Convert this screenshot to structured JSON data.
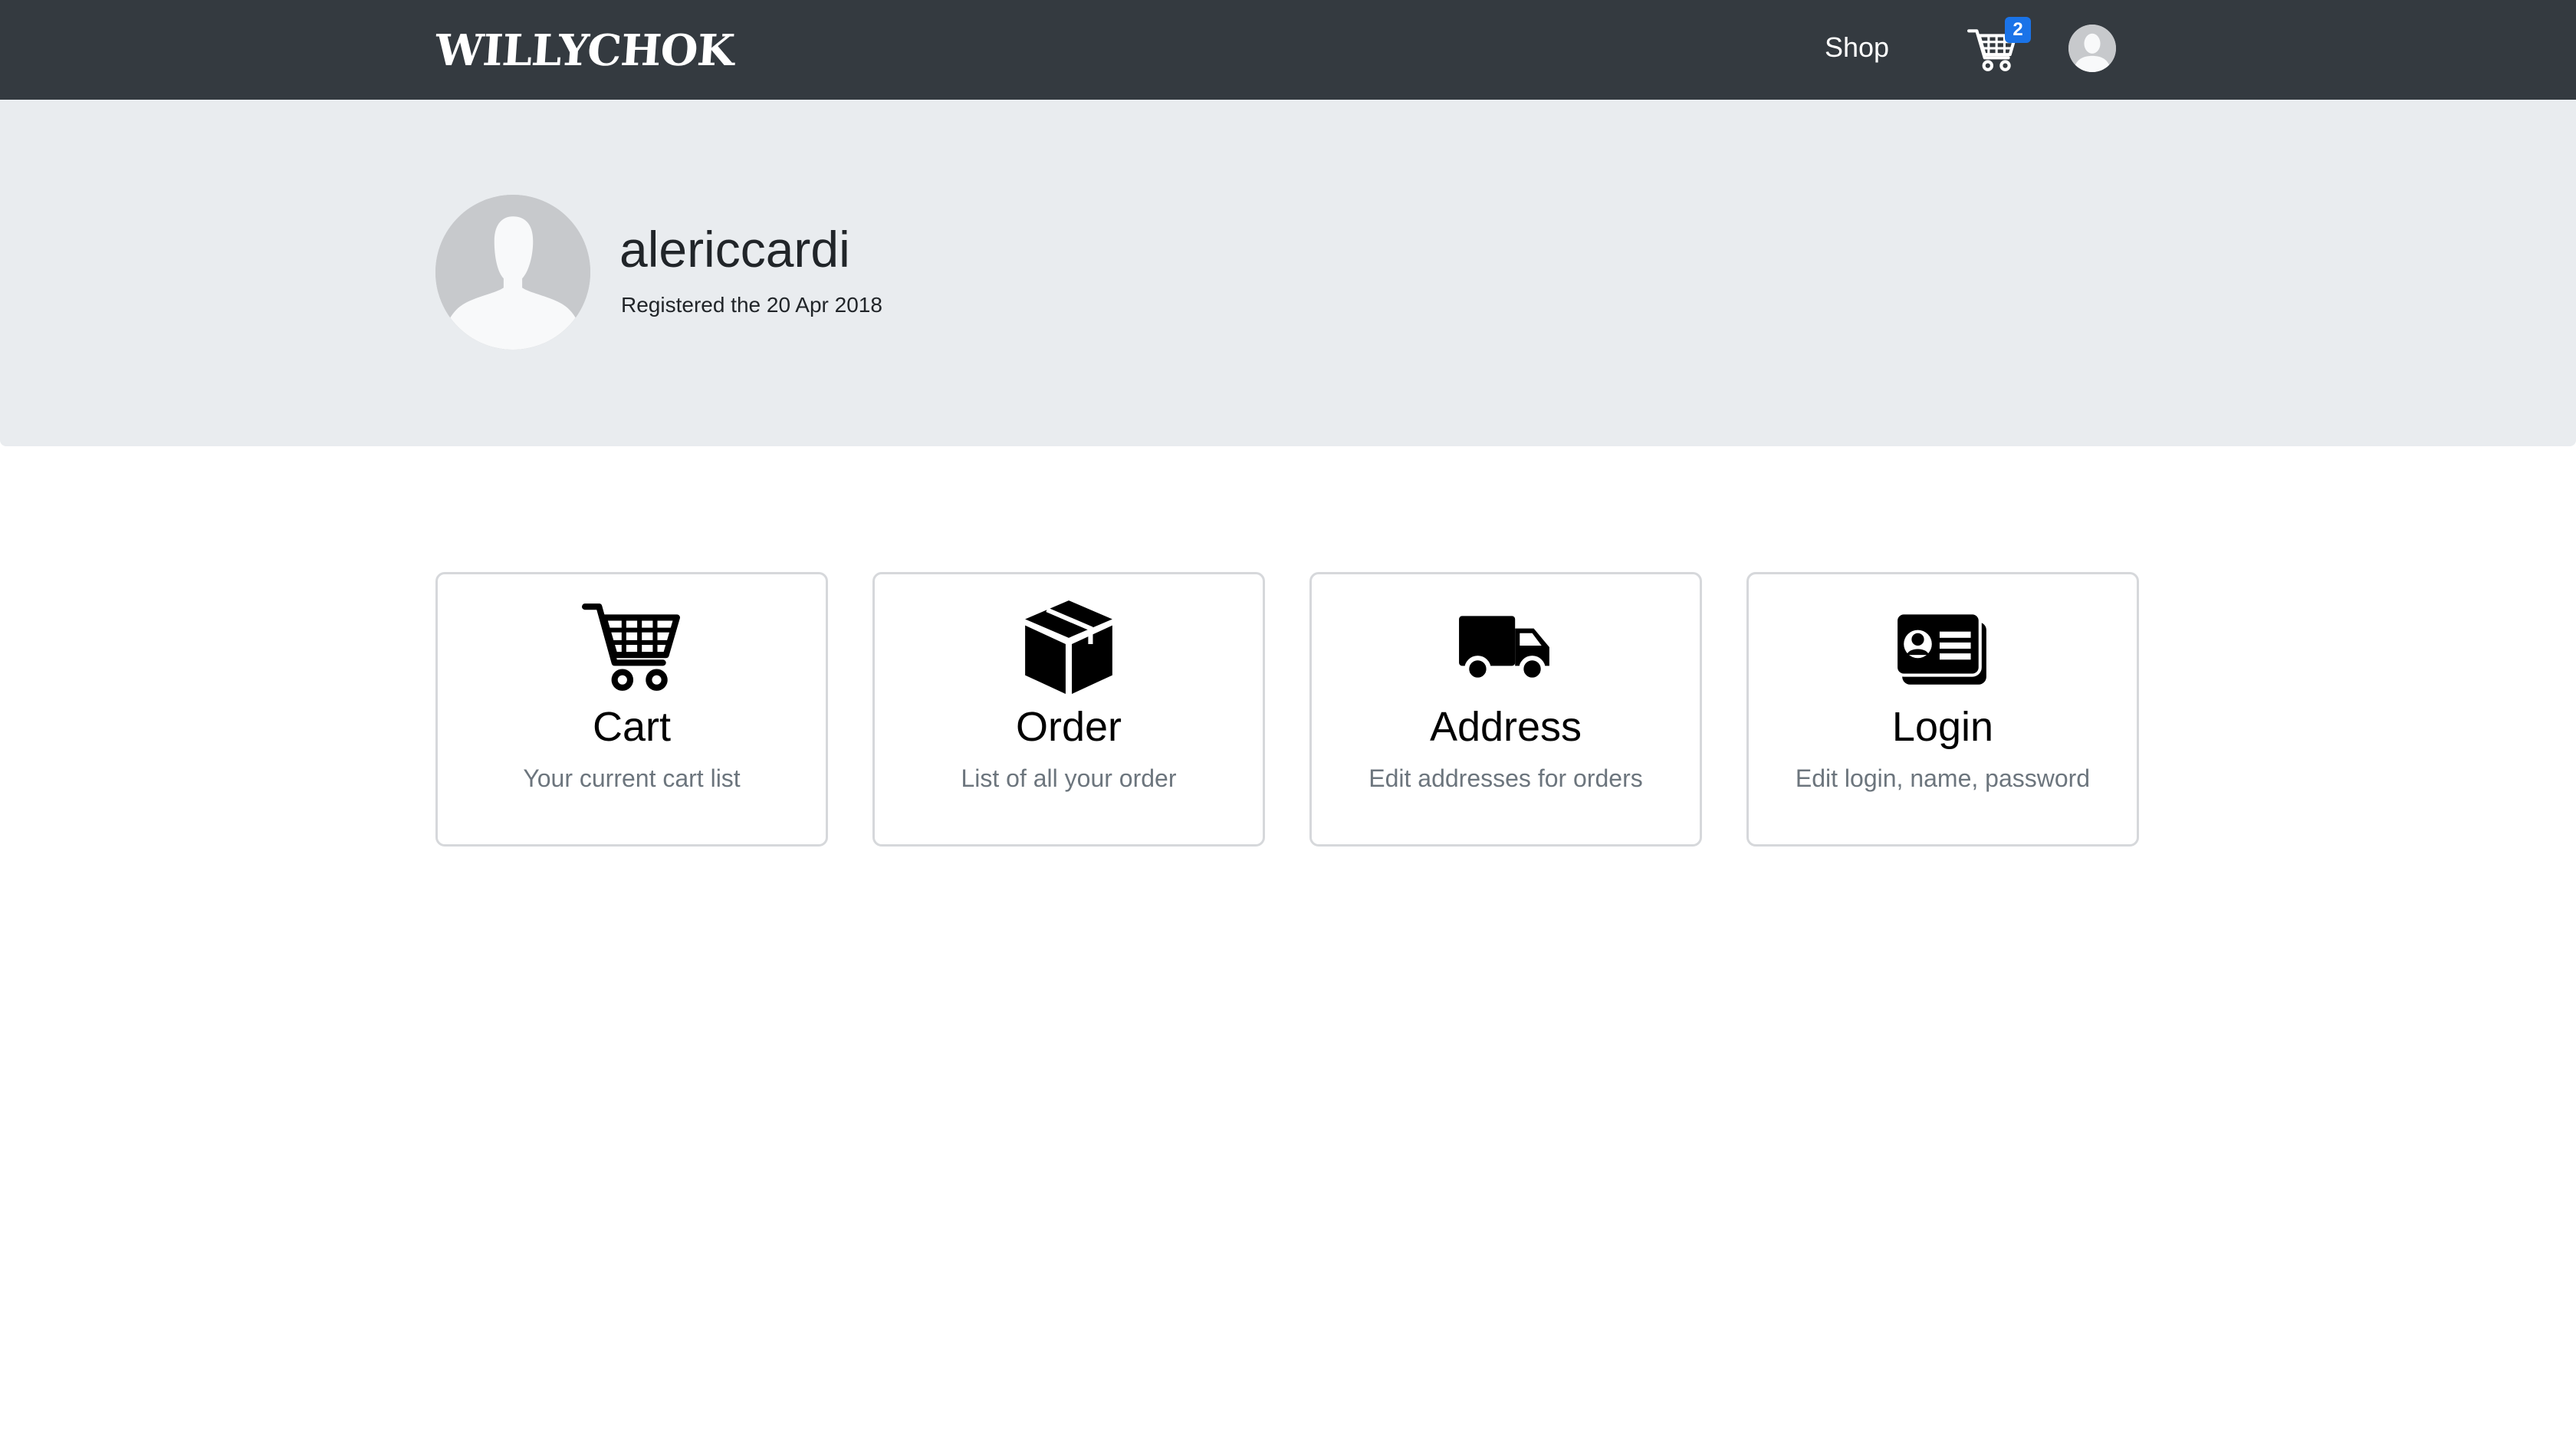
{
  "navbar": {
    "brand": "WILLYCHOK",
    "shop_label": "Shop",
    "cart_count": "2",
    "cart_icon": "cart-icon",
    "avatar_icon": "user-avatar-icon"
  },
  "profile": {
    "username": "alericcardi",
    "registered": "Registered the 20 Apr 2018"
  },
  "cards": [
    {
      "icon": "cart-icon",
      "title": "Cart",
      "text": "Your current cart list"
    },
    {
      "icon": "box-icon",
      "title": "Order",
      "text": "List of all your order"
    },
    {
      "icon": "truck-icon",
      "title": "Address",
      "text": "Edit addresses for orders"
    },
    {
      "icon": "id-card-icon",
      "title": "Login",
      "text": "Edit login, name, password"
    }
  ],
  "colors": {
    "navbar_bg": "#343a40",
    "jumbotron_bg": "#e9ecef",
    "badge_bg": "#1a73e8",
    "muted_text": "#6c757d"
  }
}
